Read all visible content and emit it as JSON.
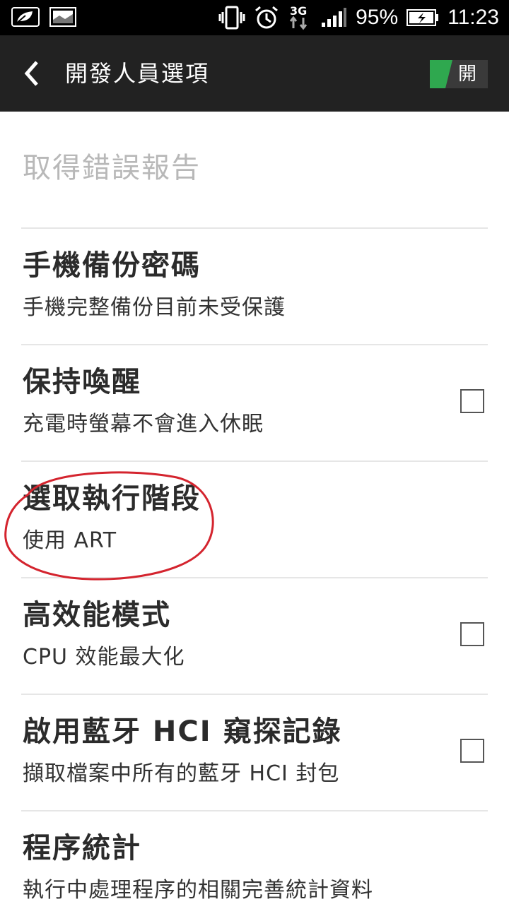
{
  "status_bar": {
    "battery": "95%",
    "time": "11:23",
    "network": "3G"
  },
  "action_bar": {
    "title": "開發人員選項",
    "toggle_label": "開",
    "accent_color": "#2fa84f"
  },
  "settings": {
    "items": [
      {
        "title": "取得錯誤報告",
        "subtitle": ""
      },
      {
        "title": "手機備份密碼",
        "subtitle": "手機完整備份目前未受保護"
      },
      {
        "title": "保持喚醒",
        "subtitle": "充電時螢幕不會進入休眠",
        "checked": false
      },
      {
        "title": "選取執行階段",
        "subtitle": "使用 ART"
      },
      {
        "title": "高效能模式",
        "subtitle": "CPU 效能最大化",
        "checked": false
      },
      {
        "title": "啟用藍牙 HCI 窺探記錄",
        "subtitle": "擷取檔案中所有的藍牙 HCI 封包",
        "checked": false
      },
      {
        "title": "程序統計",
        "subtitle": "執行中處理程序的相關完善統計資料"
      }
    ]
  },
  "annotation_color": "#d4242e"
}
